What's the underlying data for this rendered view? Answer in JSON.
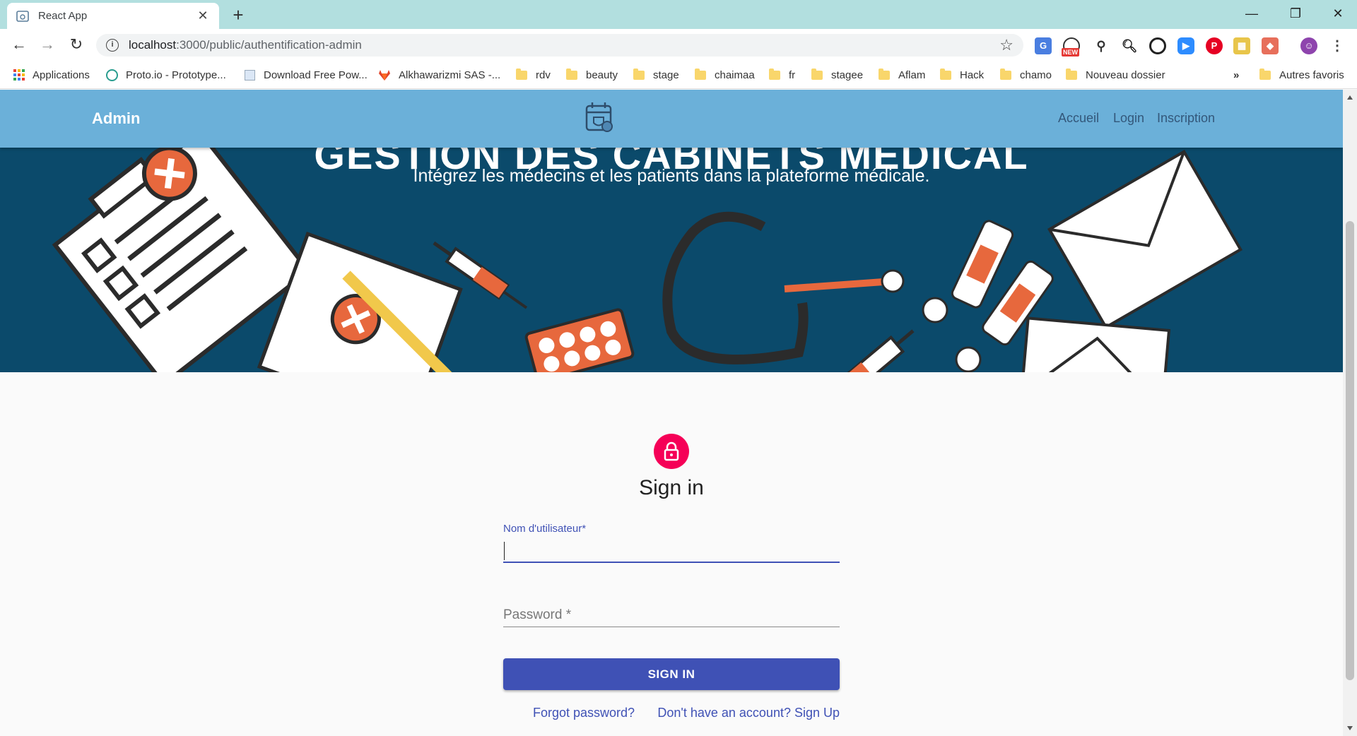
{
  "browser": {
    "tab_title": "React App",
    "url_host": "localhost",
    "url_path": ":3000/public/authentification-admin",
    "ext_new_badge": "NEW",
    "bookmarks": [
      {
        "label": "Applications",
        "icon": "apps-grid-icon"
      },
      {
        "label": "Proto.io - Prototype...",
        "icon": "proto-icon"
      },
      {
        "label": "Download Free Pow...",
        "icon": "page-icon"
      },
      {
        "label": "Alkhawarizmi SAS -...",
        "icon": "gitlab-icon"
      },
      {
        "label": "rdv",
        "icon": "folder-icon"
      },
      {
        "label": "beauty",
        "icon": "folder-icon"
      },
      {
        "label": "stage",
        "icon": "folder-icon"
      },
      {
        "label": "chaimaa",
        "icon": "folder-icon"
      },
      {
        "label": "fr",
        "icon": "folder-icon"
      },
      {
        "label": "stagee",
        "icon": "folder-icon"
      },
      {
        "label": "Aflam",
        "icon": "folder-icon"
      },
      {
        "label": "Hack",
        "icon": "folder-icon"
      },
      {
        "label": "chamo",
        "icon": "folder-icon"
      },
      {
        "label": "Nouveau dossier",
        "icon": "folder-icon"
      }
    ],
    "bookmarks_overflow": "»",
    "other_bookmarks": "Autres favoris"
  },
  "appbar": {
    "brand": "Admin",
    "links": [
      "Accueil",
      "Login",
      "Inscription"
    ]
  },
  "hero": {
    "title": "GESTION DES CABINETS MEDICAL",
    "subtitle": "Intégrez les médecins et les patients dans la plateforme médicale."
  },
  "signin": {
    "heading": "Sign in",
    "username_label": "Nom d'utilisateur",
    "required_mark": "*",
    "username_value": "",
    "password_placeholder": "Password *",
    "submit_label": "SIGN IN",
    "forgot_link": "Forgot password?",
    "signup_link": "Don't have an account? Sign Up"
  },
  "colors": {
    "appbar": "#6bb0d9",
    "hero_bg": "#0b4a6b",
    "primary": "#3f51b5",
    "lock_avatar": "#f50057",
    "tabstrip": "#b2dfdf"
  }
}
